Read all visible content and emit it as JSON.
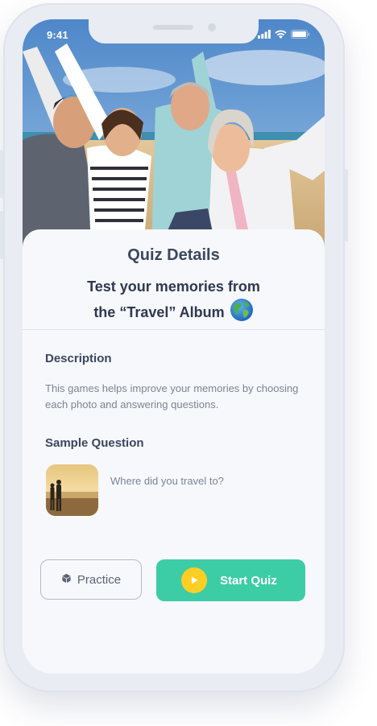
{
  "status_bar": {
    "time": "9:41"
  },
  "quiz": {
    "title": "Quiz Details",
    "subtitle_line1": "Test your memories from",
    "subtitle_line2": "the “Travel” Album",
    "subtitle_emoji_icon": "globe-icon"
  },
  "description": {
    "heading": "Description",
    "text": "This games helps improve your memories by choosing each photo and answering questions."
  },
  "sample": {
    "heading": "Sample Question",
    "question": "Where did you travel to?"
  },
  "actions": {
    "practice_label": "Practice",
    "practice_icon": "cube-icon",
    "start_label": "Start Quiz",
    "start_icon": "play-icon"
  },
  "colors": {
    "accent": "#3ccda6",
    "play_icon_bg": "#ffce23",
    "heading": "#3b4660",
    "body_text": "#7c8497"
  }
}
